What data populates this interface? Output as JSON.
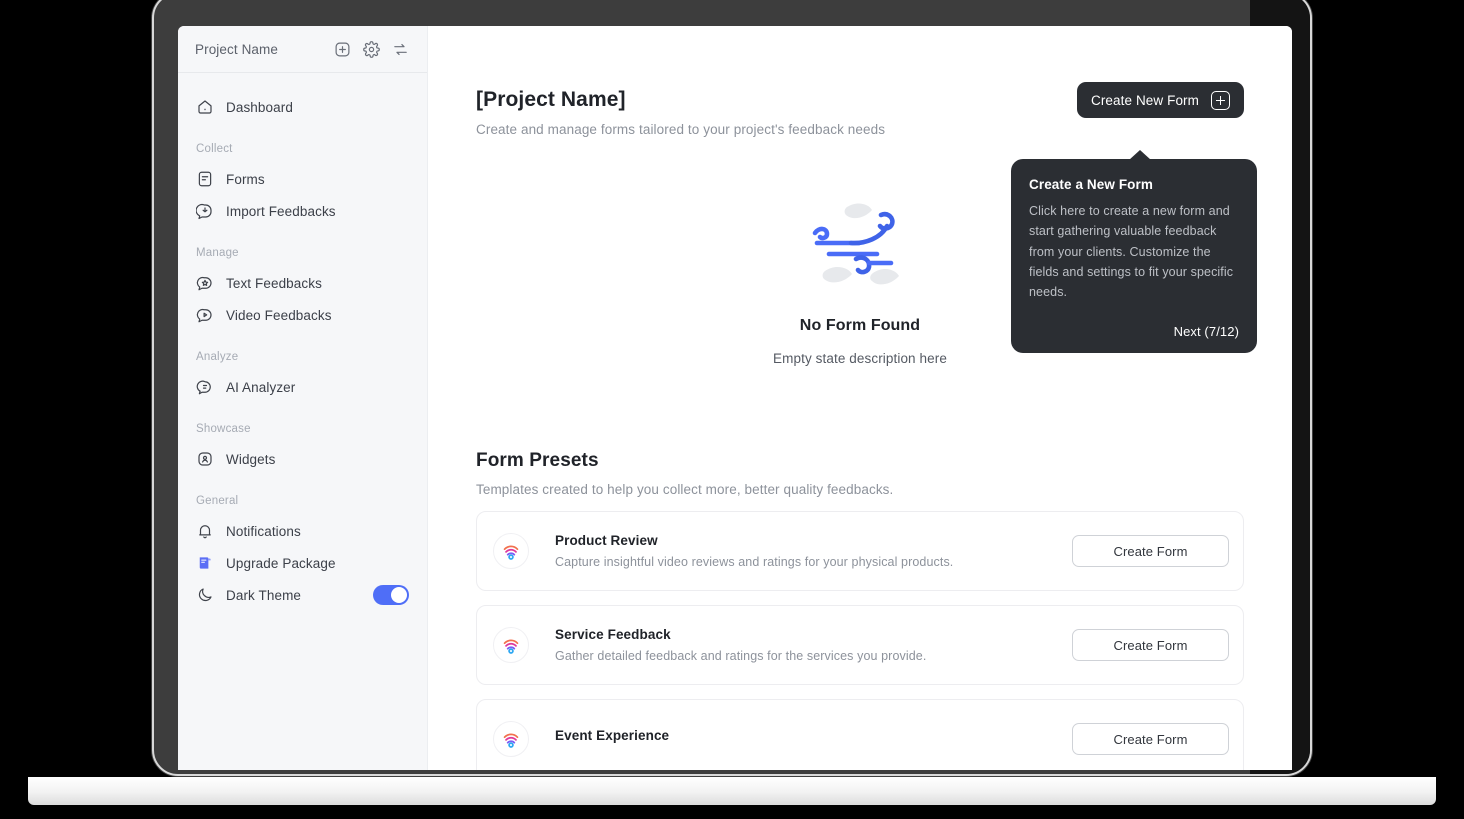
{
  "sidebar": {
    "project_title": "Project Name",
    "header_icons": [
      {
        "name": "add-icon"
      },
      {
        "name": "settings-gear-icon"
      },
      {
        "name": "switch-project-icon"
      }
    ],
    "top_items": [
      {
        "label": "Dashboard",
        "icon": "dashboard-home-icon"
      }
    ],
    "groups": [
      {
        "label": "Collect",
        "items": [
          {
            "label": "Forms",
            "icon": "form-document-icon"
          },
          {
            "label": "Import Feedbacks",
            "icon": "import-feedback-icon"
          }
        ]
      },
      {
        "label": "Manage",
        "items": [
          {
            "label": "Text Feedbacks",
            "icon": "text-feedback-icon"
          },
          {
            "label": "Video Feedbacks",
            "icon": "video-feedback-icon"
          }
        ]
      },
      {
        "label": "Analyze",
        "items": [
          {
            "label": "AI Analyzer",
            "icon": "ai-analyzer-icon"
          }
        ]
      },
      {
        "label": "Showcase",
        "items": [
          {
            "label": "Widgets",
            "icon": "widgets-icon"
          }
        ]
      },
      {
        "label": "General",
        "items": [
          {
            "label": "Notifications",
            "icon": "bell-icon"
          },
          {
            "label": "Upgrade Package",
            "icon": "upgrade-package-icon"
          },
          {
            "label": "Dark Theme",
            "icon": "moon-icon"
          }
        ]
      }
    ],
    "dark_theme_toggle": {
      "state": "on",
      "accent": "#4f6ef7"
    }
  },
  "main": {
    "page_title": "[Project Name]",
    "page_subtitle": "Create and manage forms tailored to your project's feedback needs",
    "create_button_label": "Create New Form",
    "empty_state": {
      "title": "No Form Found",
      "description": "Empty state description here",
      "illustration": "wind-leaves-illustration"
    },
    "presets": {
      "title": "Form Presets",
      "subtitle": "Templates created to help you collect more, better quality feedbacks.",
      "action_label": "Create Form",
      "items": [
        {
          "name": "Product Review",
          "description": "Capture insightful video reviews and ratings for your physical products.",
          "action": "Create Form"
        },
        {
          "name": "Service Feedback",
          "description": "Gather detailed feedback and ratings for the services you provide.",
          "action": "Create Form"
        },
        {
          "name": "Event Experience",
          "description": "",
          "action": "Create Form"
        }
      ]
    }
  },
  "tooltip": {
    "title": "Create a New Form",
    "body": "Click here to create a new form and start gathering valuable feedback from your clients. Customize the fields and settings to fit your specific needs.",
    "next_label": "Next (7/12)"
  }
}
